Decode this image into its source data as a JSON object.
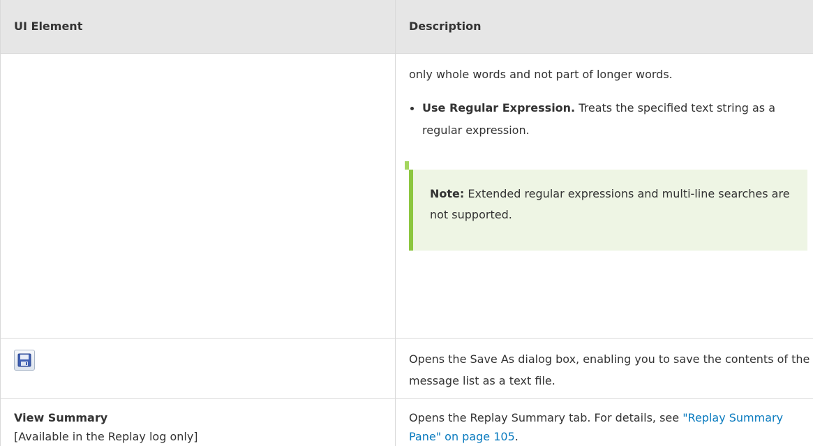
{
  "table": {
    "headers": [
      "UI Element",
      "Description"
    ],
    "row1": {
      "continuation_text": "only whole words and not part of longer words.",
      "bullet": {
        "term": "Use Regular Expression.",
        "text": " Treats the specified text string as a regular expression."
      },
      "note": {
        "label": "Note:",
        "text": " Extended regular expressions and multi-line searches are not supported."
      }
    },
    "row2": {
      "icon": "save-floppy-icon",
      "description": "Opens the Save As dialog box, enabling you to save the contents of the message list as a text file."
    },
    "row3": {
      "element_title": "View Summary",
      "element_note": "[Available in the Replay log only]",
      "description_prefix": "Opens the Replay Summary tab. For details, see ",
      "link_text": "\"Replay Summary Pane\" on page 105",
      "description_suffix": "."
    }
  },
  "colors": {
    "header_bg": "#e6e6e6",
    "note_bg": "#eef5e4",
    "note_bar": "#8cc63f",
    "link": "#0a7bbf"
  }
}
